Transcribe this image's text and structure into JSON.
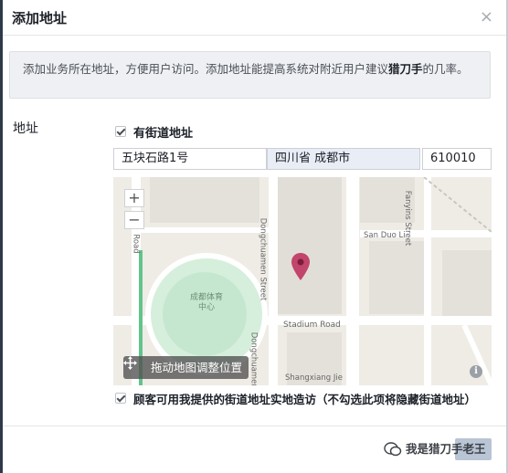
{
  "dialog": {
    "title": "添加地址",
    "close_icon": "×"
  },
  "info": {
    "text_prefix": "添加业务所在地址，方便用户访问。添加地址能提高系统对附近用户建议",
    "text_bold": "猎刀手",
    "text_suffix": "的几率。"
  },
  "address": {
    "label": "地址",
    "has_street_label": "有街道地址",
    "street_value": "五块石路1号",
    "city_value": "四川省 成都市",
    "zip_value": "610010"
  },
  "map": {
    "zoom_in": "+",
    "zoom_out": "−",
    "drag_label": "拖动地图调整位置",
    "info_icon": "i",
    "labels": {
      "stadium": "成都体育中心",
      "street1": "Dongchuamen Street",
      "street2": "Dongchuamen Street",
      "stadium_road": "Stadium Road",
      "san_duo": "San Duo Li",
      "fanyins": "Fanyins Street",
      "shangxiang": "Shangxiang Jie",
      "road_left": "Road"
    },
    "pin_color": "#c2456b"
  },
  "visitors": {
    "label": "顾客可用我提供的街道地址实地造访（不勾选此项将隐藏街道地址）"
  },
  "footer": {
    "watermark_text": "我是猎刀手老王"
  }
}
